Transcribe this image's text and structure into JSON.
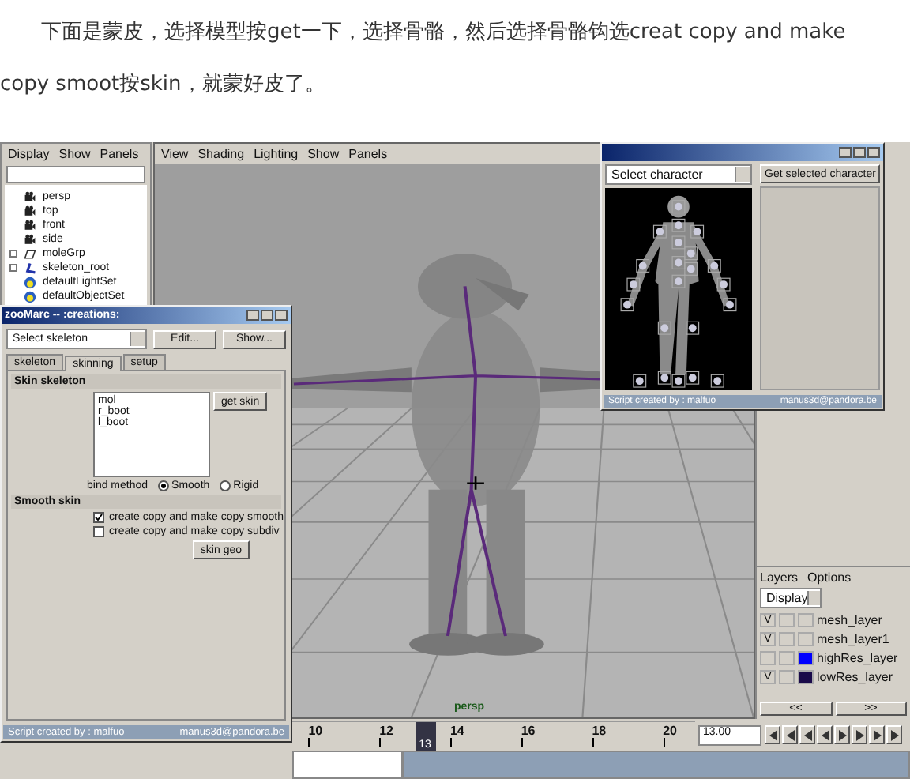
{
  "article": {
    "paragraph": "下面是蒙皮，选择模型按get一下，选择骨骼，然后选择骨骼钩选creat copy and make copy smoot按skin，就蒙好皮了。"
  },
  "maya": {
    "outliner": {
      "menu": [
        "Display",
        "Show",
        "Panels"
      ],
      "items": [
        {
          "label": "persp",
          "kind": "camera",
          "expandable": false
        },
        {
          "label": "top",
          "kind": "camera",
          "expandable": false
        },
        {
          "label": "front",
          "kind": "camera",
          "expandable": false
        },
        {
          "label": "side",
          "kind": "camera",
          "expandable": false
        },
        {
          "label": "moleGrp",
          "kind": "group",
          "expandable": true
        },
        {
          "label": "skeleton_root",
          "kind": "joint",
          "expandable": true
        },
        {
          "label": "defaultLightSet",
          "kind": "set",
          "expandable": false
        },
        {
          "label": "defaultObjectSet",
          "kind": "set",
          "expandable": false
        }
      ]
    },
    "viewport": {
      "menu": [
        "View",
        "Shading",
        "Lighting",
        "Show",
        "Panels"
      ],
      "camera_label": "persp"
    },
    "character_window": {
      "dropdown": "Select character",
      "button": "Get selected character",
      "footer": [
        "Script created by : malfuo",
        "manus3d@pandora.be"
      ]
    },
    "skin_dialog": {
      "title": "zooMarc -- :creations:",
      "dropdown": "Select skeleton",
      "buttons": [
        "Edit...",
        "Show..."
      ],
      "tabs": [
        {
          "label": "skeleton",
          "selected": false
        },
        {
          "label": "skinning",
          "selected": true
        },
        {
          "label": "setup",
          "selected": false
        }
      ],
      "skin_section": "Skin skeleton",
      "list": [
        "mol",
        "r_boot",
        "l_boot"
      ],
      "get_button": "get skin",
      "bind_label": "bind method",
      "bind_options": [
        {
          "label": "Smooth",
          "selected": true
        },
        {
          "label": "Rigid",
          "selected": false
        }
      ],
      "smooth_section": "Smooth skin",
      "options": [
        {
          "label": "create copy and make copy smooth",
          "checked": true
        },
        {
          "label": "create copy and make copy subdiv",
          "checked": false
        }
      ],
      "action_button": "skin geo",
      "footer": [
        "Script created by : malfuo",
        "manus3d@pandora.be"
      ]
    },
    "layers": {
      "menu": [
        "Layers",
        "Options"
      ],
      "dropdown": "Display",
      "items": [
        {
          "name": "mesh_layer",
          "visibility": "V"
        },
        {
          "name": "mesh_layer1",
          "visibility": "V"
        },
        {
          "name": "highRes_layer",
          "color": "#0000ff"
        },
        {
          "name": "lowRes_layer",
          "visibility": "V",
          "color": "#1a0a4a"
        }
      ],
      "scroll_buttons": [
        "<<",
        ">>"
      ]
    },
    "timeline": {
      "ticks": [
        "10",
        "12",
        "14",
        "16",
        "18",
        "20"
      ],
      "current": "13",
      "field": "13.00"
    }
  }
}
